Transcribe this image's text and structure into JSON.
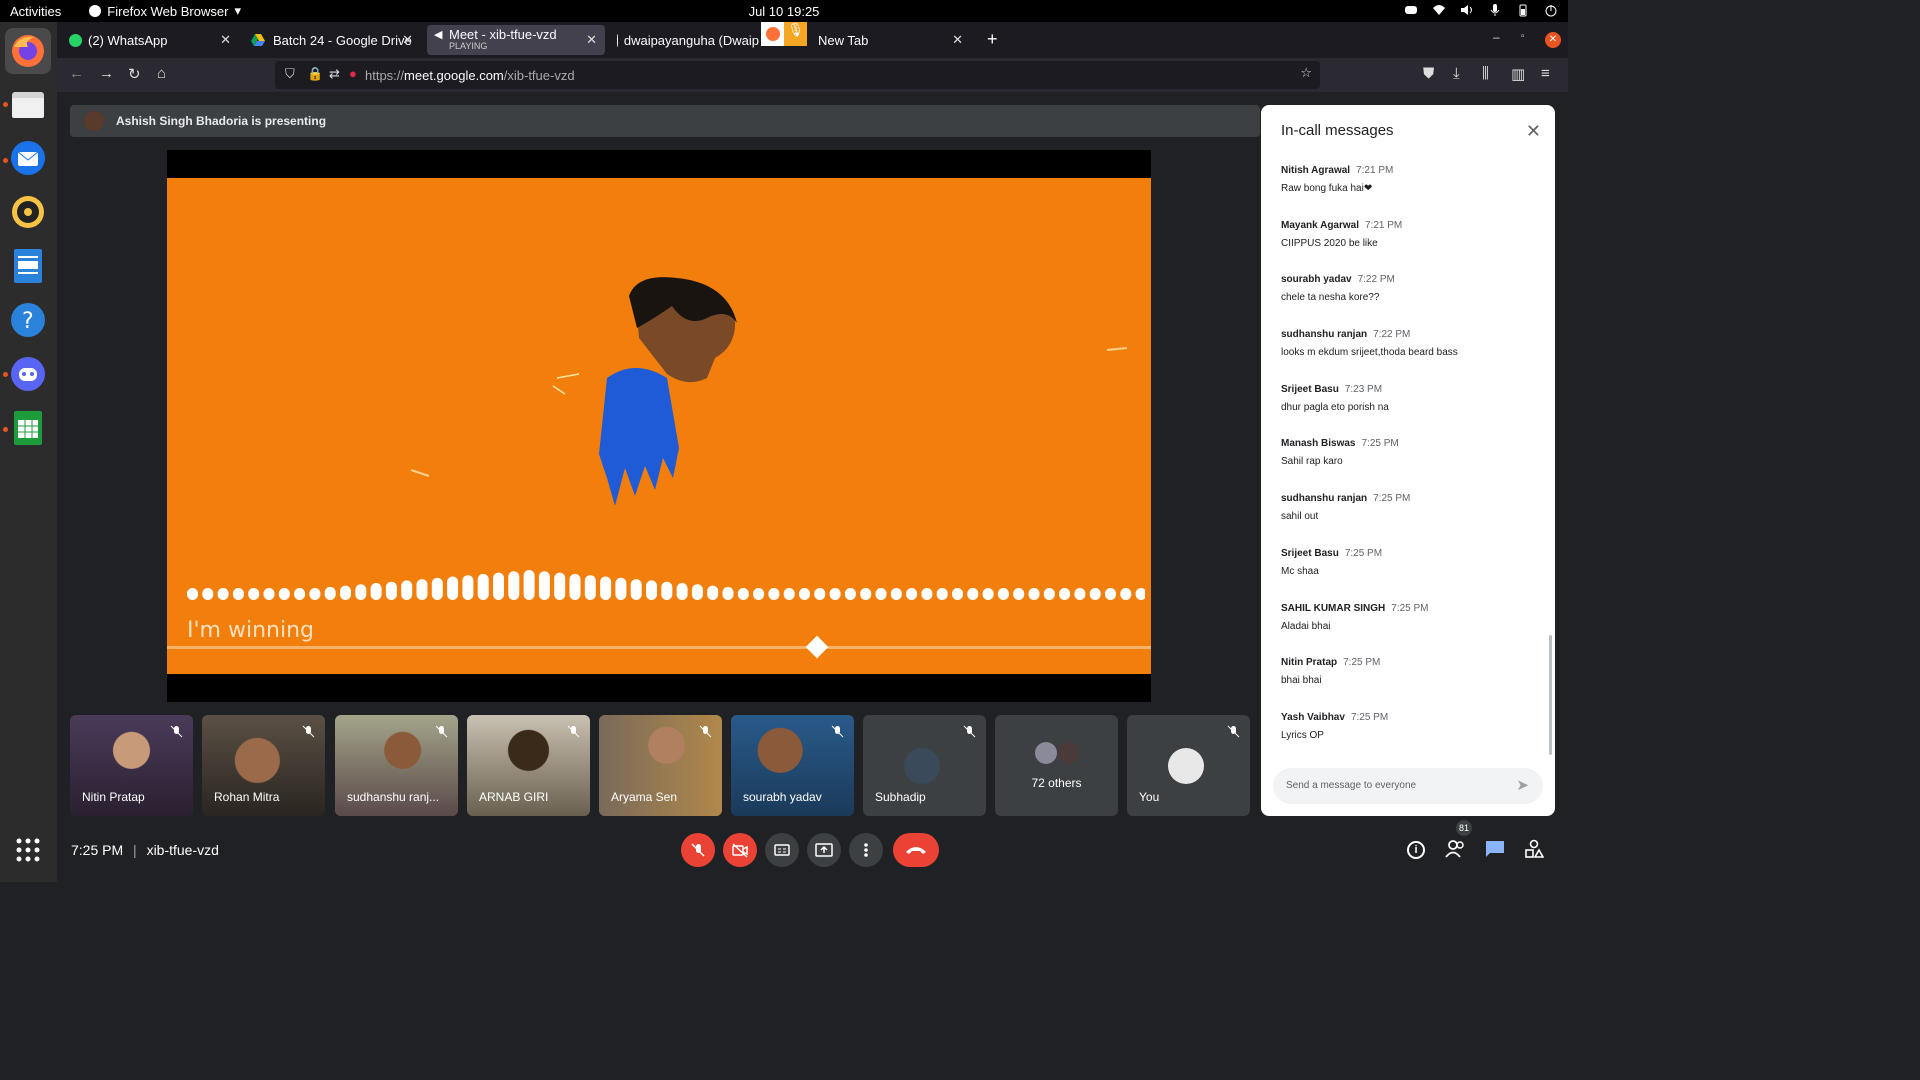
{
  "topbar": {
    "activities": "Activities",
    "app": "Firefox Web Browser",
    "clock": "Jul 10  19:25"
  },
  "tabs": [
    {
      "label": "(2) WhatsApp"
    },
    {
      "label": "Batch 24 - Google Drive"
    },
    {
      "label": "Meet - xib-tfue-vzd",
      "sub": "PLAYING"
    },
    {
      "label": "dwaipayanguha (Dwaip"
    },
    {
      "label": "New Tab"
    }
  ],
  "url": {
    "prefix": "https://",
    "domain": "meet.google.com",
    "path": "/xib-tfue-vzd"
  },
  "meet": {
    "presenting": "Ashish Singh Bhadoria is presenting",
    "caption": "I'm winning",
    "participants": [
      "Nitin Pratap",
      "Rohan Mitra",
      "sudhanshu ranj...",
      "ARNAB GIRI",
      "Aryama Sen",
      "sourabh yadav",
      "Subhadip",
      "72 others",
      "You"
    ],
    "time": "7:25 PM",
    "separator": "|",
    "code": "xib-tfue-vzd",
    "people_count": "81"
  },
  "chat": {
    "title": "In-call messages",
    "placeholder": "Send a message to everyone",
    "messages": [
      {
        "who": "Nitish Agrawal",
        "when": "7:21 PM",
        "text": "Raw bong fuka hai❤"
      },
      {
        "who": "Mayank Agarwal",
        "when": "7:21 PM",
        "text": "CIIPPUS 2020 be like"
      },
      {
        "who": "sourabh yadav",
        "when": "7:22 PM",
        "text": "chele ta nesha kore??"
      },
      {
        "who": "sudhanshu ranjan",
        "when": "7:22 PM",
        "text": "looks m ekdum srijeet,thoda beard bass"
      },
      {
        "who": "Srijeet Basu",
        "when": "7:23 PM",
        "text": "dhur pagla eto porish na"
      },
      {
        "who": "Manash Biswas",
        "when": "7:25 PM",
        "text": "Sahil rap karo"
      },
      {
        "who": "sudhanshu ranjan",
        "when": "7:25 PM",
        "text": "sahil out"
      },
      {
        "who": "Srijeet Basu",
        "when": "7:25 PM",
        "text": "Mc shaa"
      },
      {
        "who": "SAHIL KUMAR SINGH",
        "when": "7:25 PM",
        "text": "Aladai bhai"
      },
      {
        "who": "Nitin Pratap",
        "when": "7:25 PM",
        "text": "bhai bhai"
      },
      {
        "who": "Yash Vaibhav",
        "when": "7:25 PM",
        "text": "Lyrics OP"
      }
    ]
  },
  "colors": {
    "accent": "#8ab4f8",
    "red": "#ea4335",
    "video": "#f27f0c"
  }
}
